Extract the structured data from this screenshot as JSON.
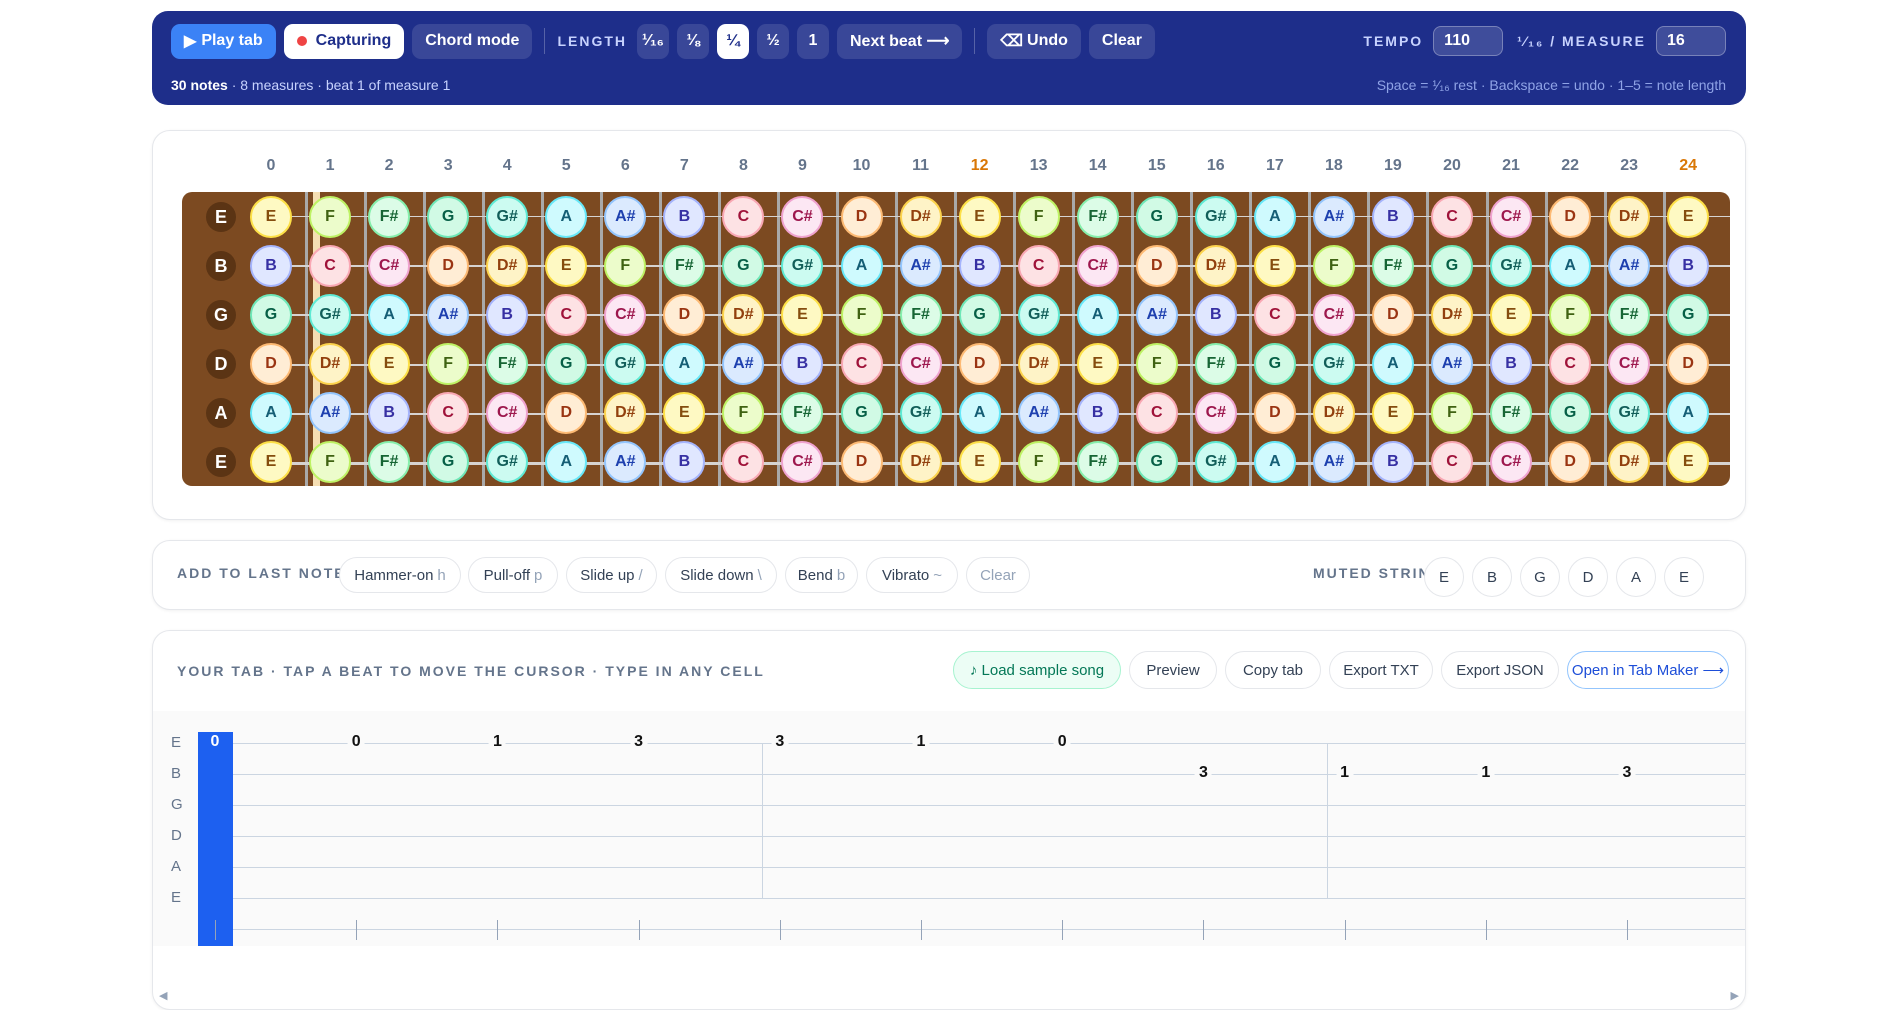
{
  "toolbar": {
    "play": "Play tab",
    "capturing": "Capturing",
    "chord_mode": "Chord mode",
    "length_label": "LENGTH",
    "lengths": [
      "¹⁄₁₆",
      "⅛",
      "¼",
      "½",
      "1"
    ],
    "active_length_index": 2,
    "next_beat": "Next beat ⟶",
    "undo": "Undo",
    "clear": "Clear",
    "tempo_label": "TEMPO",
    "tempo": "110",
    "per_measure_label": "¹⁄₁₆ / MEASURE",
    "per_measure": "16",
    "status_count": "30 notes",
    "status_rest": "· 8 measures · beat 1 of measure 1",
    "hint": "Space = ¹⁄₁₆ rest · Backspace = undo · 1–5 = note length"
  },
  "fretboard": {
    "fret_numbers": [
      "0",
      "1",
      "2",
      "3",
      "4",
      "5",
      "6",
      "7",
      "8",
      "9",
      "10",
      "11",
      "12",
      "13",
      "14",
      "15",
      "16",
      "17",
      "18",
      "19",
      "20",
      "21",
      "22",
      "23",
      "24"
    ],
    "marked_frets": [
      12,
      24
    ],
    "strings": [
      {
        "name": "E",
        "notes": [
          "E",
          "F",
          "F#",
          "G",
          "G#",
          "A",
          "A#",
          "B",
          "C",
          "C#",
          "D",
          "D#",
          "E",
          "F",
          "F#",
          "G",
          "G#",
          "A",
          "A#",
          "B",
          "C",
          "C#",
          "D",
          "D#",
          "E"
        ]
      },
      {
        "name": "B",
        "notes": [
          "B",
          "C",
          "C#",
          "D",
          "D#",
          "E",
          "F",
          "F#",
          "G",
          "G#",
          "A",
          "A#",
          "B",
          "C",
          "C#",
          "D",
          "D#",
          "E",
          "F",
          "F#",
          "G",
          "G#",
          "A",
          "A#",
          "B"
        ]
      },
      {
        "name": "G",
        "notes": [
          "G",
          "G#",
          "A",
          "A#",
          "B",
          "C",
          "C#",
          "D",
          "D#",
          "E",
          "F",
          "F#",
          "G",
          "G#",
          "A",
          "A#",
          "B",
          "C",
          "C#",
          "D",
          "D#",
          "E",
          "F",
          "F#",
          "G"
        ]
      },
      {
        "name": "D",
        "notes": [
          "D",
          "D#",
          "E",
          "F",
          "F#",
          "G",
          "G#",
          "A",
          "A#",
          "B",
          "C",
          "C#",
          "D",
          "D#",
          "E",
          "F",
          "F#",
          "G",
          "G#",
          "A",
          "A#",
          "B",
          "C",
          "C#",
          "D"
        ]
      },
      {
        "name": "A",
        "notes": [
          "A",
          "A#",
          "B",
          "C",
          "C#",
          "D",
          "D#",
          "E",
          "F",
          "F#",
          "G",
          "G#",
          "A",
          "A#",
          "B",
          "C",
          "C#",
          "D",
          "D#",
          "E",
          "F",
          "F#",
          "G",
          "G#",
          "A"
        ]
      },
      {
        "name": "E",
        "notes": [
          "E",
          "F",
          "F#",
          "G",
          "G#",
          "A",
          "A#",
          "B",
          "C",
          "C#",
          "D",
          "D#",
          "E",
          "F",
          "F#",
          "G",
          "G#",
          "A",
          "A#",
          "B",
          "C",
          "C#",
          "D",
          "D#",
          "E"
        ]
      }
    ],
    "note_colors": {
      "C": [
        "#fde2e4",
        "#f9a8b4",
        "#9f1239"
      ],
      "C#": [
        "#fce7f3",
        "#f0a3cf",
        "#9d174d"
      ],
      "D": [
        "#ffedd5",
        "#fdba74",
        "#9a3412"
      ],
      "D#": [
        "#fef3c7",
        "#fcd34d",
        "#92400e"
      ],
      "E": [
        "#fef9c3",
        "#fde047",
        "#854d0e"
      ],
      "F": [
        "#ecfccb",
        "#bef264",
        "#3f6212"
      ],
      "F#": [
        "#dcfce7",
        "#86efac",
        "#166534"
      ],
      "G": [
        "#d1fae5",
        "#6ee7b7",
        "#065f46"
      ],
      "G#": [
        "#ccfbf1",
        "#5eead4",
        "#115e59"
      ],
      "A": [
        "#cffafe",
        "#67e8f9",
        "#155e75"
      ],
      "A#": [
        "#dbeafe",
        "#93c5fd",
        "#1e40af"
      ],
      "B": [
        "#e0e7ff",
        "#a5b4fc",
        "#3730a3"
      ]
    }
  },
  "techniques": {
    "label": "ADD TO LAST NOTE",
    "items": [
      {
        "label": "Hammer-on",
        "key": "h"
      },
      {
        "label": "Pull-off",
        "key": "p"
      },
      {
        "label": "Slide up",
        "key": "/"
      },
      {
        "label": "Slide down",
        "key": "\\"
      },
      {
        "label": "Bend",
        "key": "b"
      },
      {
        "label": "Vibrato",
        "key": "~"
      }
    ],
    "clear": "Clear",
    "muted_label": "MUTED STRING ✕",
    "muted_strings": [
      "E",
      "B",
      "G",
      "D",
      "A",
      "E"
    ]
  },
  "tab": {
    "label": "YOUR TAB · TAP A BEAT TO MOVE THE CURSOR · TYPE IN ANY CELL",
    "buttons": {
      "sample": "♪ Load sample song",
      "preview": "Preview",
      "copy": "Copy tab",
      "export_txt": "Export TXT",
      "export_json": "Export JSON",
      "open": "Open in Tab Maker ⟶"
    },
    "string_names": [
      "E",
      "B",
      "G",
      "D",
      "A",
      "E"
    ],
    "notes": [
      {
        "beat": 0,
        "string": 0,
        "fret": "0"
      },
      {
        "beat": 1,
        "string": 0,
        "fret": "0"
      },
      {
        "beat": 2,
        "string": 0,
        "fret": "1"
      },
      {
        "beat": 3,
        "string": 0,
        "fret": "3"
      },
      {
        "beat": 4,
        "string": 0,
        "fret": "3"
      },
      {
        "beat": 5,
        "string": 0,
        "fret": "1"
      },
      {
        "beat": 6,
        "string": 0,
        "fret": "0"
      },
      {
        "beat": 7,
        "string": 1,
        "fret": "3"
      },
      {
        "beat": 8,
        "string": 1,
        "fret": "1"
      },
      {
        "beat": 9,
        "string": 1,
        "fret": "1"
      },
      {
        "beat": 10,
        "string": 1,
        "fret": "3"
      }
    ],
    "cursor_beat": 0,
    "measure_bars_after_beats": [
      4,
      8
    ]
  }
}
